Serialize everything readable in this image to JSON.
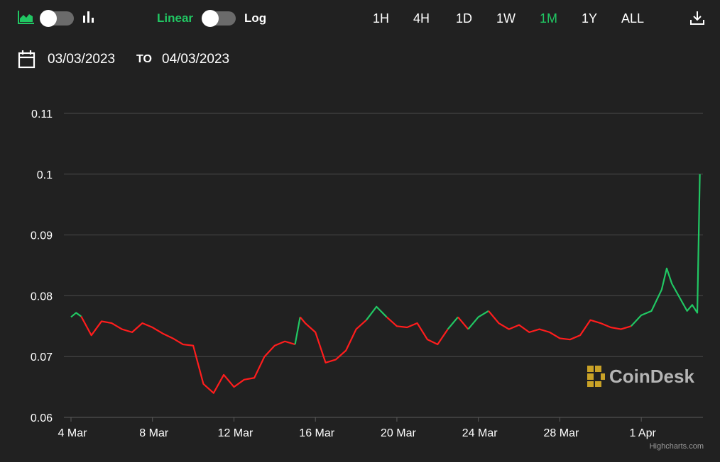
{
  "toolbar": {
    "area_chart_icon": "area-chart-icon",
    "bar_chart_icon": "bar-chart-icon",
    "scale_linear_label": "Linear",
    "scale_log_label": "Log",
    "ranges": [
      "1H",
      "4H",
      "1D",
      "1W",
      "1M",
      "1Y",
      "ALL"
    ],
    "active_range": "1M",
    "download_icon": "download-icon"
  },
  "date_range": {
    "calendar_icon": "calendar-icon",
    "from": "03/03/2023",
    "to_label": "TO",
    "to": "04/03/2023"
  },
  "watermark": {
    "text": "CoinDesk",
    "logo_icon": "coindesk-logo-icon"
  },
  "credits": "Highcharts.com",
  "colors": {
    "background": "#212121",
    "up": "#21c763",
    "down": "#ff1d1d",
    "active_range": "#21c763",
    "grid": "#4a4a4a"
  },
  "chart_data": {
    "type": "line",
    "ylim": [
      0.06,
      0.11
    ],
    "y_ticks": [
      "0.06",
      "0.07",
      "0.08",
      "0.09",
      "0.1",
      "0.11"
    ],
    "x_tick_labels": [
      "4 Mar",
      "8 Mar",
      "12 Mar",
      "16 Mar",
      "20 Mar",
      "24 Mar",
      "28 Mar",
      "1 Apr"
    ],
    "x_ticks": [
      "2023-03-04",
      "2023-03-08",
      "2023-03-12",
      "2023-03-16",
      "2023-03-20",
      "2023-03-24",
      "2023-03-28",
      "2023-04-01"
    ],
    "grid": true,
    "series": [
      {
        "x": [
          "2023-03-04 00:00",
          "2023-03-04 06:00",
          "2023-03-04 12:00",
          "2023-03-05 00:00",
          "2023-03-05 12:00",
          "2023-03-06 00:00",
          "2023-03-06 12:00",
          "2023-03-07 00:00",
          "2023-03-07 12:00",
          "2023-03-08 00:00",
          "2023-03-08 12:00",
          "2023-03-09 00:00",
          "2023-03-09 12:00",
          "2023-03-10 00:00",
          "2023-03-10 12:00",
          "2023-03-11 00:00",
          "2023-03-11 12:00",
          "2023-03-12 00:00",
          "2023-03-12 12:00",
          "2023-03-13 00:00",
          "2023-03-13 12:00",
          "2023-03-14 00:00",
          "2023-03-14 12:00",
          "2023-03-15 00:00",
          "2023-03-15 06:00",
          "2023-03-15 12:00",
          "2023-03-16 00:00",
          "2023-03-16 12:00",
          "2023-03-17 00:00",
          "2023-03-17 12:00",
          "2023-03-18 00:00",
          "2023-03-18 12:00",
          "2023-03-19 00:00",
          "2023-03-19 12:00",
          "2023-03-20 00:00",
          "2023-03-20 12:00",
          "2023-03-21 00:00",
          "2023-03-21 12:00",
          "2023-03-22 00:00",
          "2023-03-22 12:00",
          "2023-03-23 00:00",
          "2023-03-23 12:00",
          "2023-03-24 00:00",
          "2023-03-24 12:00",
          "2023-03-25 00:00",
          "2023-03-25 12:00",
          "2023-03-26 00:00",
          "2023-03-26 12:00",
          "2023-03-27 00:00",
          "2023-03-27 12:00",
          "2023-03-28 00:00",
          "2023-03-28 12:00",
          "2023-03-29 00:00",
          "2023-03-29 12:00",
          "2023-03-30 00:00",
          "2023-03-30 12:00",
          "2023-03-31 00:00",
          "2023-03-31 12:00",
          "2023-04-01 00:00",
          "2023-04-01 12:00",
          "2023-04-02 00:00",
          "2023-04-02 06:00",
          "2023-04-02 12:00",
          "2023-04-03 00:00",
          "2023-04-03 06:00",
          "2023-04-03 12:00",
          "2023-04-03 18:00",
          "2023-04-03 21:00"
        ],
        "y": [
          0.0765,
          0.0772,
          0.0766,
          0.0735,
          0.0758,
          0.0755,
          0.0745,
          0.074,
          0.0755,
          0.0748,
          0.0738,
          0.073,
          0.072,
          0.0718,
          0.0655,
          0.064,
          0.067,
          0.065,
          0.0662,
          0.0665,
          0.07,
          0.0718,
          0.0725,
          0.072,
          0.0765,
          0.0755,
          0.074,
          0.069,
          0.0695,
          0.071,
          0.0745,
          0.076,
          0.0782,
          0.0765,
          0.075,
          0.0748,
          0.0755,
          0.0728,
          0.072,
          0.0745,
          0.0765,
          0.0745,
          0.0765,
          0.0775,
          0.0755,
          0.0745,
          0.0752,
          0.074,
          0.0745,
          0.074,
          0.073,
          0.0728,
          0.0735,
          0.076,
          0.0755,
          0.0748,
          0.0745,
          0.075,
          0.0768,
          0.0775,
          0.081,
          0.0845,
          0.082,
          0.079,
          0.0775,
          0.0785,
          0.0772,
          0.1
        ]
      }
    ]
  }
}
